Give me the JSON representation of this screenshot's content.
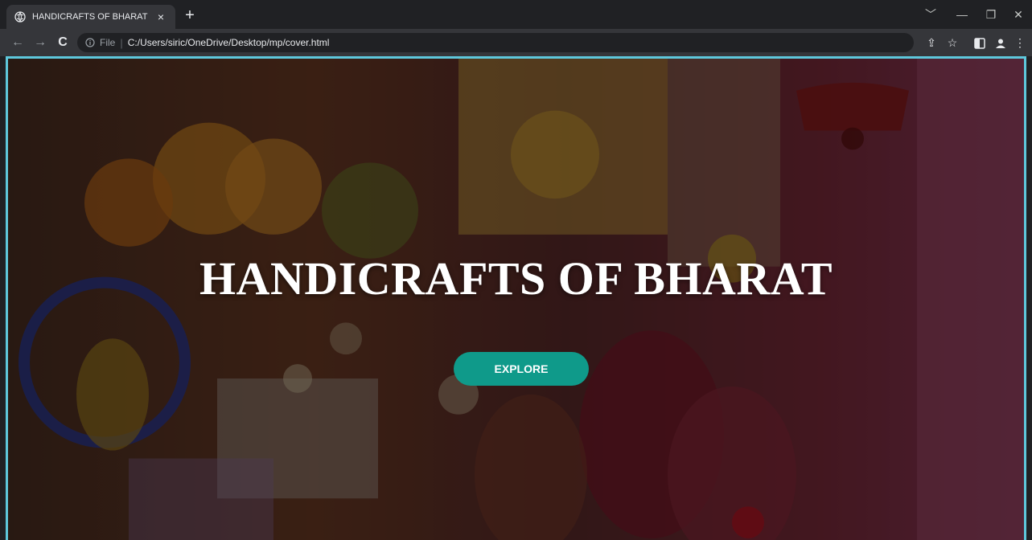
{
  "browser": {
    "tab": {
      "title": "HANDICRAFTS OF BHARAT",
      "favicon": "globe-icon",
      "close_label": "×"
    },
    "new_tab_label": "+",
    "window_controls": {
      "collapse_label": "﹀",
      "minimize_label": "—",
      "restore_label": "❐",
      "close_label": "✕"
    },
    "nav": {
      "back_label": "←",
      "forward_label": "→",
      "reload_label": "C"
    },
    "address_bar": {
      "scheme": "File",
      "separator": "|",
      "url": "C:/Users/siric/OneDrive/Desktop/mp/cover.html"
    },
    "toolbar_icons": {
      "share_label": "⇪",
      "bookmark_label": "☆",
      "menu_label": "⋮"
    }
  },
  "page": {
    "hero_title": "HANDICRAFTS OF BHARAT",
    "explore_label": "EXPLORE",
    "accent_color": "#0f9a8a",
    "frame_color": "#5ec8dc"
  }
}
